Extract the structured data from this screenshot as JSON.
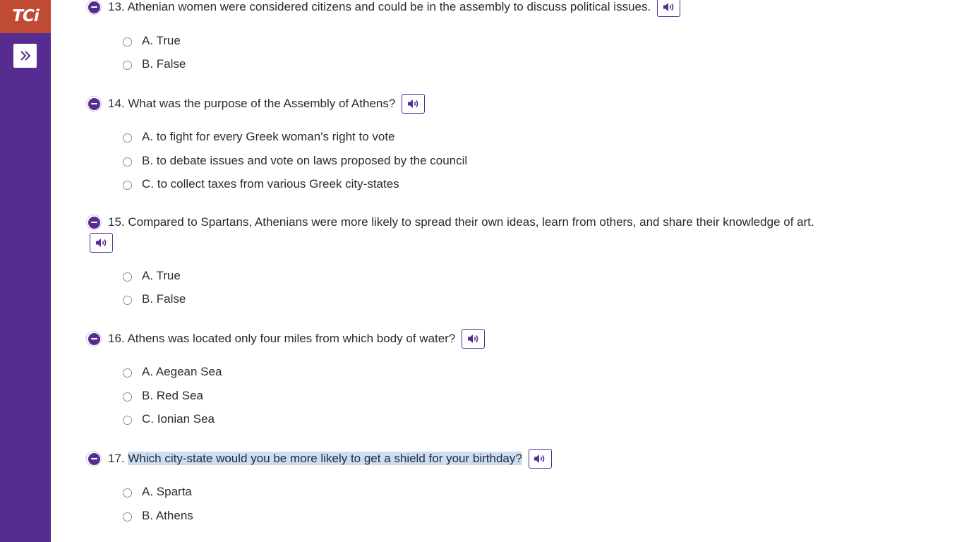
{
  "app": {
    "logo_text": "TCi"
  },
  "sidebar": {
    "expand_icon": "double-chevron-right-icon"
  },
  "questions": [
    {
      "number": "13.",
      "text": "Athenian women were considered citizens and could be in the assembly to discuss political issues.",
      "options": [
        "A. True",
        "B. False"
      ]
    },
    {
      "number": "14.",
      "text": "What was the purpose of the Assembly of Athens?",
      "options": [
        "A. to fight for every Greek woman's right to vote",
        "B. to debate issues and vote on laws proposed by the council",
        "C. to collect taxes from various Greek city-states"
      ]
    },
    {
      "number": "15.",
      "text": "Compared to Spartans, Athenians were more likely to spread their own ideas, learn from others, and share their knowledge of art.",
      "options": [
        "A. True",
        "B. False"
      ]
    },
    {
      "number": "16.",
      "text": "Athens was located only four miles from which body of water?",
      "options": [
        "A. Aegean Sea",
        "B. Red Sea",
        "C. Ionian Sea"
      ]
    },
    {
      "number": "17.",
      "text": "Which city-state would you be more likely to get a shield for your birthday?",
      "options": [
        "A. Sparta",
        "B. Athens"
      ]
    }
  ],
  "colors": {
    "sidebar": "#562c90",
    "logo_bg": "#c04a34",
    "accent": "#562c90",
    "highlight": "#c9ddf3"
  }
}
